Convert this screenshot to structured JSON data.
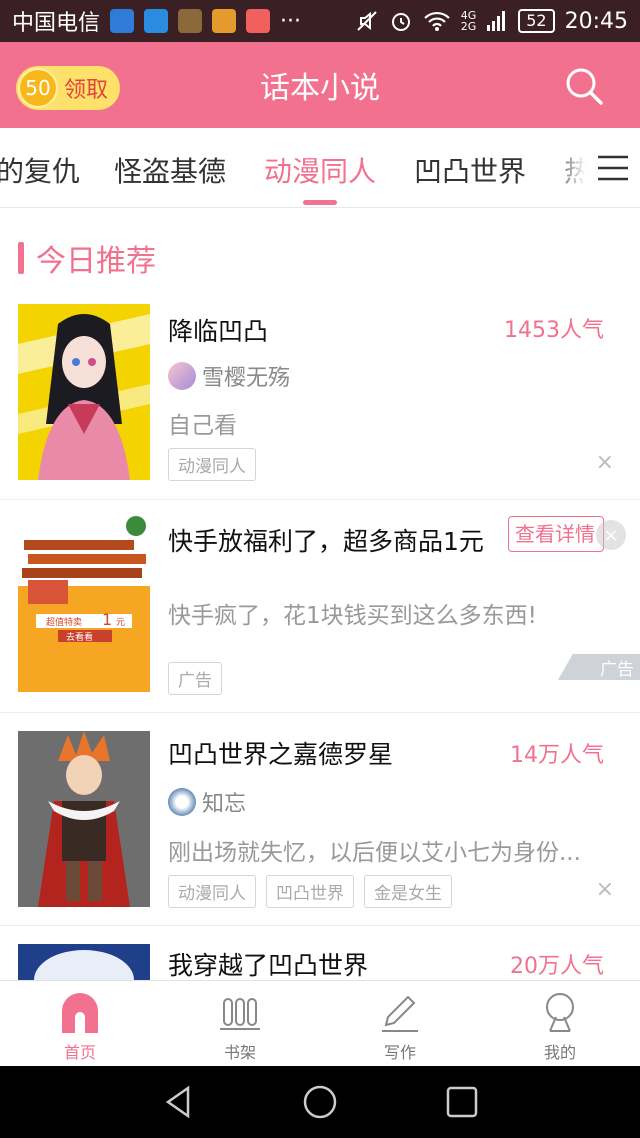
{
  "status_bar": {
    "carrier": "中国电信",
    "network": "4G",
    "network2": "2G",
    "battery": "52",
    "time": "20:45"
  },
  "header": {
    "coins": "50",
    "claim_label": "领取",
    "title": "话本小说"
  },
  "tabs": [
    {
      "label": "的复仇"
    },
    {
      "label": "怪盗基德"
    },
    {
      "label": "动漫同人",
      "active": true
    },
    {
      "label": "凹凸世界"
    },
    {
      "label": "热"
    }
  ],
  "section": {
    "title": "今日推荐"
  },
  "feed": [
    {
      "title": "降临凹凸",
      "popularity": "1453人气",
      "author": "雪樱无殇",
      "description": "自己看",
      "tags": [
        "动漫同人"
      ],
      "close": "×"
    },
    {
      "title": "快手放福利了，超多商品1元",
      "cta": "查看详情",
      "description": "快手疯了，花1块钱买到这么多东西!",
      "tag": "广告",
      "ad_mark": "广告",
      "close": "×",
      "cover_badge": "超值特卖",
      "cover_price": "1",
      "cover_unit": "元",
      "cover_button": "去看看"
    },
    {
      "title": "凹凸世界之嘉德罗星",
      "popularity": "14万人气",
      "author": "知忘",
      "description": "刚出场就失忆，以后便以艾小七为身份...",
      "tags": [
        "动漫同人",
        "凹凸世界",
        "金是女生"
      ],
      "close": "×"
    },
    {
      "title": "我穿越了凹凸世界",
      "popularity": "20万人气"
    }
  ],
  "bottom_nav": [
    {
      "label": "首页",
      "icon": "home-icon",
      "active": true
    },
    {
      "label": "书架",
      "icon": "bookshelf-icon"
    },
    {
      "label": "写作",
      "icon": "pencil-icon"
    },
    {
      "label": "我的",
      "icon": "profile-icon"
    }
  ],
  "colors": {
    "accent": "#f1718f",
    "status_bar": "#3a1f25",
    "coin_pill": "#fde16a"
  }
}
